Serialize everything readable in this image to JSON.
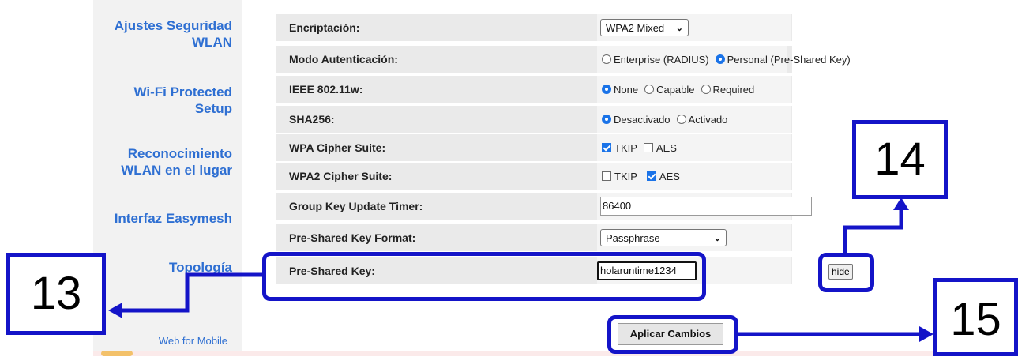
{
  "sidebar": {
    "items": [
      {
        "lines": [
          "Ajustes Seguridad",
          "WLAN"
        ]
      },
      {
        "lines": [
          "Wi-Fi Protected",
          "Setup"
        ]
      },
      {
        "lines": [
          "Reconocimiento",
          "WLAN en el lugar"
        ]
      },
      {
        "lines": [
          "Interfaz Easymesh"
        ]
      },
      {
        "lines": [
          "Topología"
        ]
      }
    ],
    "web_for_mobile": "Web for Mobile"
  },
  "form": {
    "encryption": {
      "label": "Encriptación:",
      "value": "WPA2 Mixed"
    },
    "auth_mode": {
      "label": "Modo Autenticación:",
      "options": [
        {
          "label": "Enterprise (RADIUS)",
          "selected": false
        },
        {
          "label": "Personal (Pre-Shared Key)",
          "selected": true
        }
      ]
    },
    "ieee80211w": {
      "label": "IEEE 802.11w:",
      "options": [
        {
          "label": "None",
          "selected": true
        },
        {
          "label": "Capable",
          "selected": false
        },
        {
          "label": "Required",
          "selected": false
        }
      ]
    },
    "sha256": {
      "label": "SHA256:",
      "options": [
        {
          "label": "Desactivado",
          "selected": true
        },
        {
          "label": "Activado",
          "selected": false
        }
      ]
    },
    "wpa_cipher": {
      "label": "WPA Cipher Suite:",
      "options": [
        {
          "label": "TKIP",
          "checked": true
        },
        {
          "label": "AES",
          "checked": false
        }
      ]
    },
    "wpa2_cipher": {
      "label": "WPA2 Cipher Suite:",
      "options": [
        {
          "label": "TKIP",
          "checked": false
        },
        {
          "label": "AES",
          "checked": true
        }
      ]
    },
    "group_key_timer": {
      "label": "Group Key Update Timer:",
      "value": "86400"
    },
    "psk_format": {
      "label": "Pre-Shared Key Format:",
      "value": "Passphrase"
    },
    "psk": {
      "label": "Pre-Shared Key:",
      "value": "holaruntime1234",
      "hide_label": "hide"
    }
  },
  "apply_label": "Aplicar Cambios",
  "annotations": {
    "n13": "13",
    "n14": "14",
    "n15": "15",
    "color": "#1414c8"
  }
}
